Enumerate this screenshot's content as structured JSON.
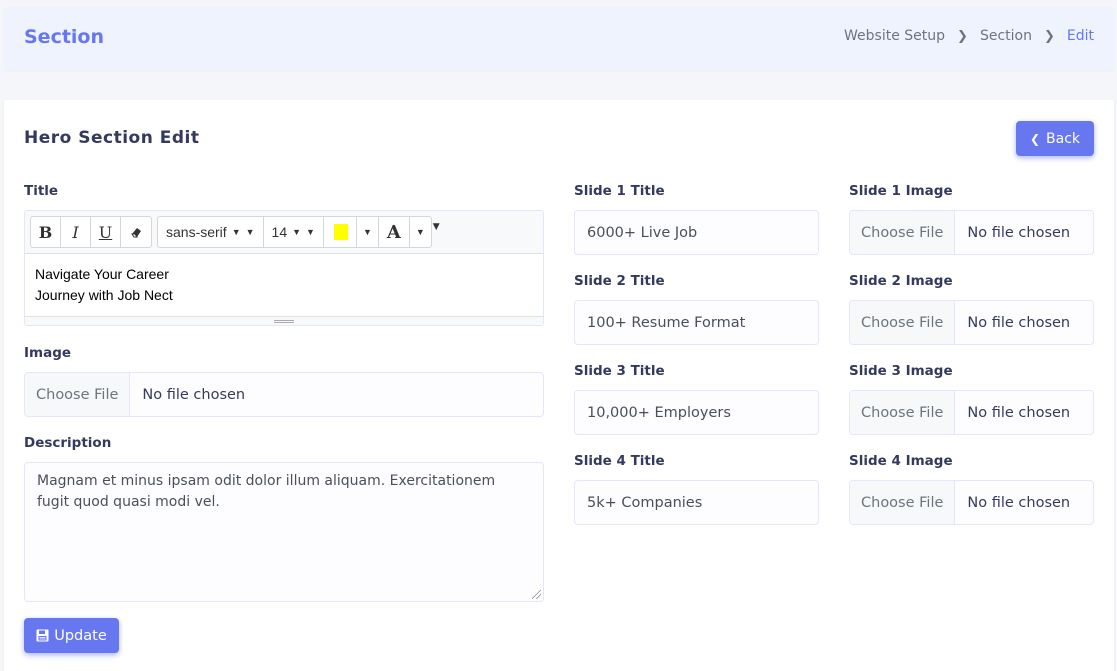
{
  "header": {
    "title": "Section",
    "breadcrumb": [
      "Website Setup",
      "Section",
      "Edit"
    ]
  },
  "card": {
    "title": "Hero Section Edit",
    "back_label": "Back"
  },
  "form": {
    "title_label": "Title",
    "editor": {
      "font_family": "sans-serif",
      "font_size": "14",
      "content_lines": [
        "Navigate Your Career",
        "Journey with Job Nect"
      ]
    },
    "image_label": "Image",
    "description_label": "Description",
    "description_value": "Magnam et minus ipsam odit dolor illum aliquam. Exercitationem fugit quod quasi modi vel.",
    "update_label": "Update"
  },
  "file_input": {
    "choose_label": "Choose File",
    "no_file_label": "No file chosen"
  },
  "slides": [
    {
      "title_label": "Slide 1 Title",
      "title_value": "6000+ Live Job",
      "image_label": "Slide 1 Image"
    },
    {
      "title_label": "Slide 2 Title",
      "title_value": "100+ Resume Format",
      "image_label": "Slide 2 Image"
    },
    {
      "title_label": "Slide 3 Title",
      "title_value": "10,000+ Employers",
      "image_label": "Slide 3 Image"
    },
    {
      "title_label": "Slide 4 Title",
      "title_value": "5k+ Companies",
      "image_label": "Slide 4 Image"
    }
  ],
  "colors": {
    "primary": "#6777ef",
    "highlight": "#ffff00"
  },
  "icons": {
    "breadcrumb_separator": "chevron-right-icon",
    "back": "chevron-left-icon",
    "update": "save-icon"
  }
}
